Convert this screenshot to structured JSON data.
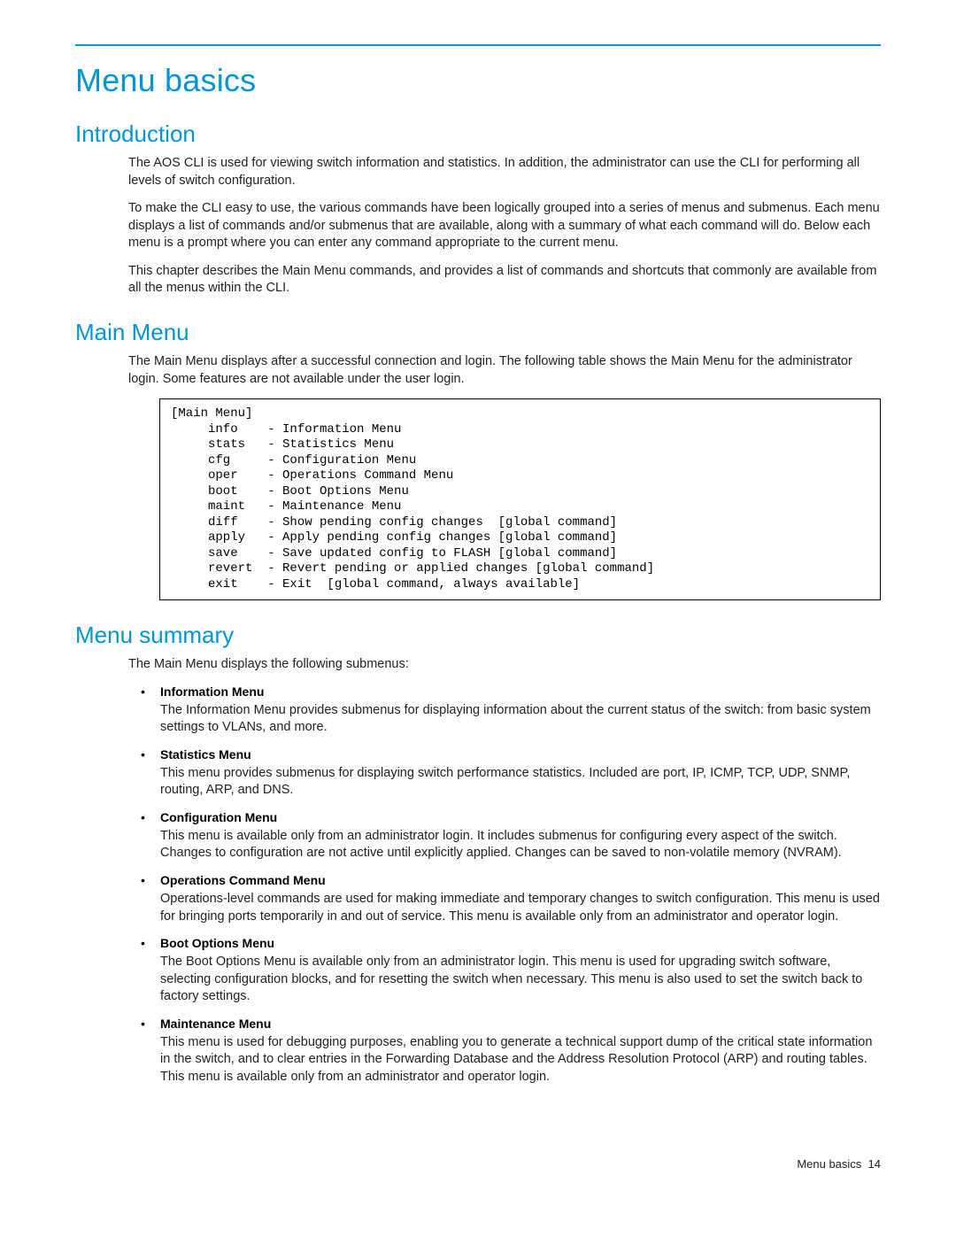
{
  "title": "Menu basics",
  "sections": {
    "intro": {
      "heading": "Introduction",
      "p1": "The AOS CLI is used for viewing switch information and statistics. In addition, the administrator can use the CLI for performing all levels of switch configuration.",
      "p2": "To make the CLI easy to use, the various commands have been logically grouped into a series of menus and submenus. Each menu displays a list of commands and/or submenus that are available, along with a summary of what each command will do. Below each menu is a prompt where you can enter any command appropriate to the current menu.",
      "p3": "This chapter describes the Main Menu commands, and provides a list of commands and shortcuts that commonly are available from all the menus within the CLI."
    },
    "main_menu": {
      "heading": "Main Menu",
      "p1": "The Main Menu displays after a successful connection and login. The following table shows the Main Menu for the administrator login. Some features are not available under the user login.",
      "code": "[Main Menu]\n     info    - Information Menu\n     stats   - Statistics Menu\n     cfg     - Configuration Menu\n     oper    - Operations Command Menu\n     boot    - Boot Options Menu\n     maint   - Maintenance Menu\n     diff    - Show pending config changes  [global command]\n     apply   - Apply pending config changes [global command]\n     save    - Save updated config to FLASH [global command]\n     revert  - Revert pending or applied changes [global command]\n     exit    - Exit  [global command, always available]"
    },
    "summary": {
      "heading": "Menu summary",
      "p1": "The Main Menu displays the following submenus:",
      "items": [
        {
          "title": "Information Menu",
          "desc": "The Information Menu provides submenus for displaying information about the current status of the switch: from basic system settings to VLANs, and more."
        },
        {
          "title": "Statistics Menu",
          "desc": "This menu provides submenus for displaying switch performance statistics. Included are port, IP, ICMP, TCP, UDP, SNMP, routing, ARP, and DNS."
        },
        {
          "title": "Configuration Menu",
          "desc": "This menu is available only from an administrator login. It includes submenus for configuring every aspect of the switch. Changes to configuration are not active until explicitly applied. Changes can be saved to non-volatile memory (NVRAM)."
        },
        {
          "title": "Operations Command Menu",
          "desc": "Operations-level commands are used for making immediate and temporary changes to switch configuration. This menu is used for bringing ports temporarily in and out of service. This menu is available only from an administrator and operator login."
        },
        {
          "title": "Boot Options Menu",
          "desc": "The Boot Options Menu is available only from an administrator login. This menu is used for upgrading switch software, selecting configuration blocks, and for resetting the switch when necessary. This menu is also used to set the switch back to factory settings."
        },
        {
          "title": "Maintenance Menu",
          "desc": "This menu is used for debugging purposes, enabling you to generate a technical support dump of the critical state information in the switch, and to clear entries in the Forwarding Database and the Address Resolution Protocol (ARP) and routing tables. This menu is available only from an administrator and operator login."
        }
      ]
    }
  },
  "footer": {
    "label": "Menu basics",
    "page": "14"
  }
}
